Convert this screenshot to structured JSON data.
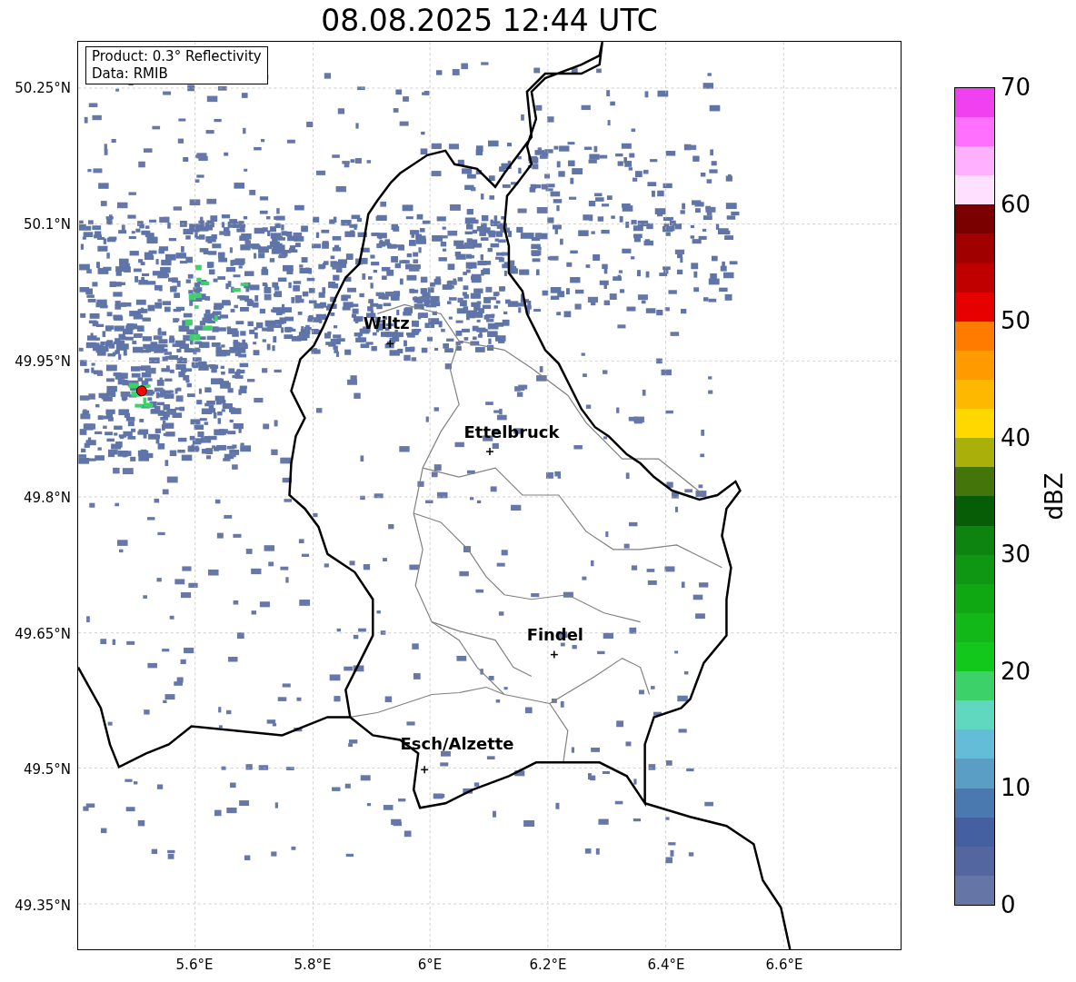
{
  "title": "08.08.2025 12:44 UTC",
  "info_box": {
    "lines": [
      "Product: 0.3° Reflectivity",
      "Data: RMIB"
    ]
  },
  "y_ticks": [
    "50.25°N",
    "50.1°N",
    "49.95°N",
    "49.8°N",
    "49.65°N",
    "49.5°N",
    "49.35°N"
  ],
  "x_ticks": [
    "5.6°E",
    "5.8°E",
    "6°E",
    "6.2°E",
    "6.4°E",
    "6.6°E"
  ],
  "cities": [
    {
      "name": "Wiltz"
    },
    {
      "name": "Ettelbruck"
    },
    {
      "name": "Findel"
    },
    {
      "name": "Esch/Alzette"
    }
  ],
  "colorbar": {
    "label": "dBZ",
    "ticks": [
      "70",
      "60",
      "50",
      "40",
      "30",
      "20",
      "10",
      "0"
    ],
    "bins": [
      {
        "color": "#6475a6"
      },
      {
        "color": "#5366a0"
      },
      {
        "color": "#4560a0"
      },
      {
        "color": "#4a79b0"
      },
      {
        "color": "#5a9ec5"
      },
      {
        "color": "#63bcd8"
      },
      {
        "color": "#60d8c0"
      },
      {
        "color": "#3dd16a"
      },
      {
        "color": "#12c81a"
      },
      {
        "color": "#12b818"
      },
      {
        "color": "#10a812"
      },
      {
        "color": "#0f9612"
      },
      {
        "color": "#0d8410"
      },
      {
        "color": "#075c06"
      },
      {
        "color": "#44750a"
      },
      {
        "color": "#a9b00a"
      },
      {
        "color": "#ffd800"
      },
      {
        "color": "#ffb800"
      },
      {
        "color": "#ff9a00"
      },
      {
        "color": "#ff7b00"
      },
      {
        "color": "#e60000"
      },
      {
        "color": "#c00000"
      },
      {
        "color": "#a00000"
      },
      {
        "color": "#7a0000"
      },
      {
        "color": "#ffe0ff"
      },
      {
        "color": "#ffb0ff"
      },
      {
        "color": "#ff70ff"
      },
      {
        "color": "#f040f0"
      }
    ]
  }
}
